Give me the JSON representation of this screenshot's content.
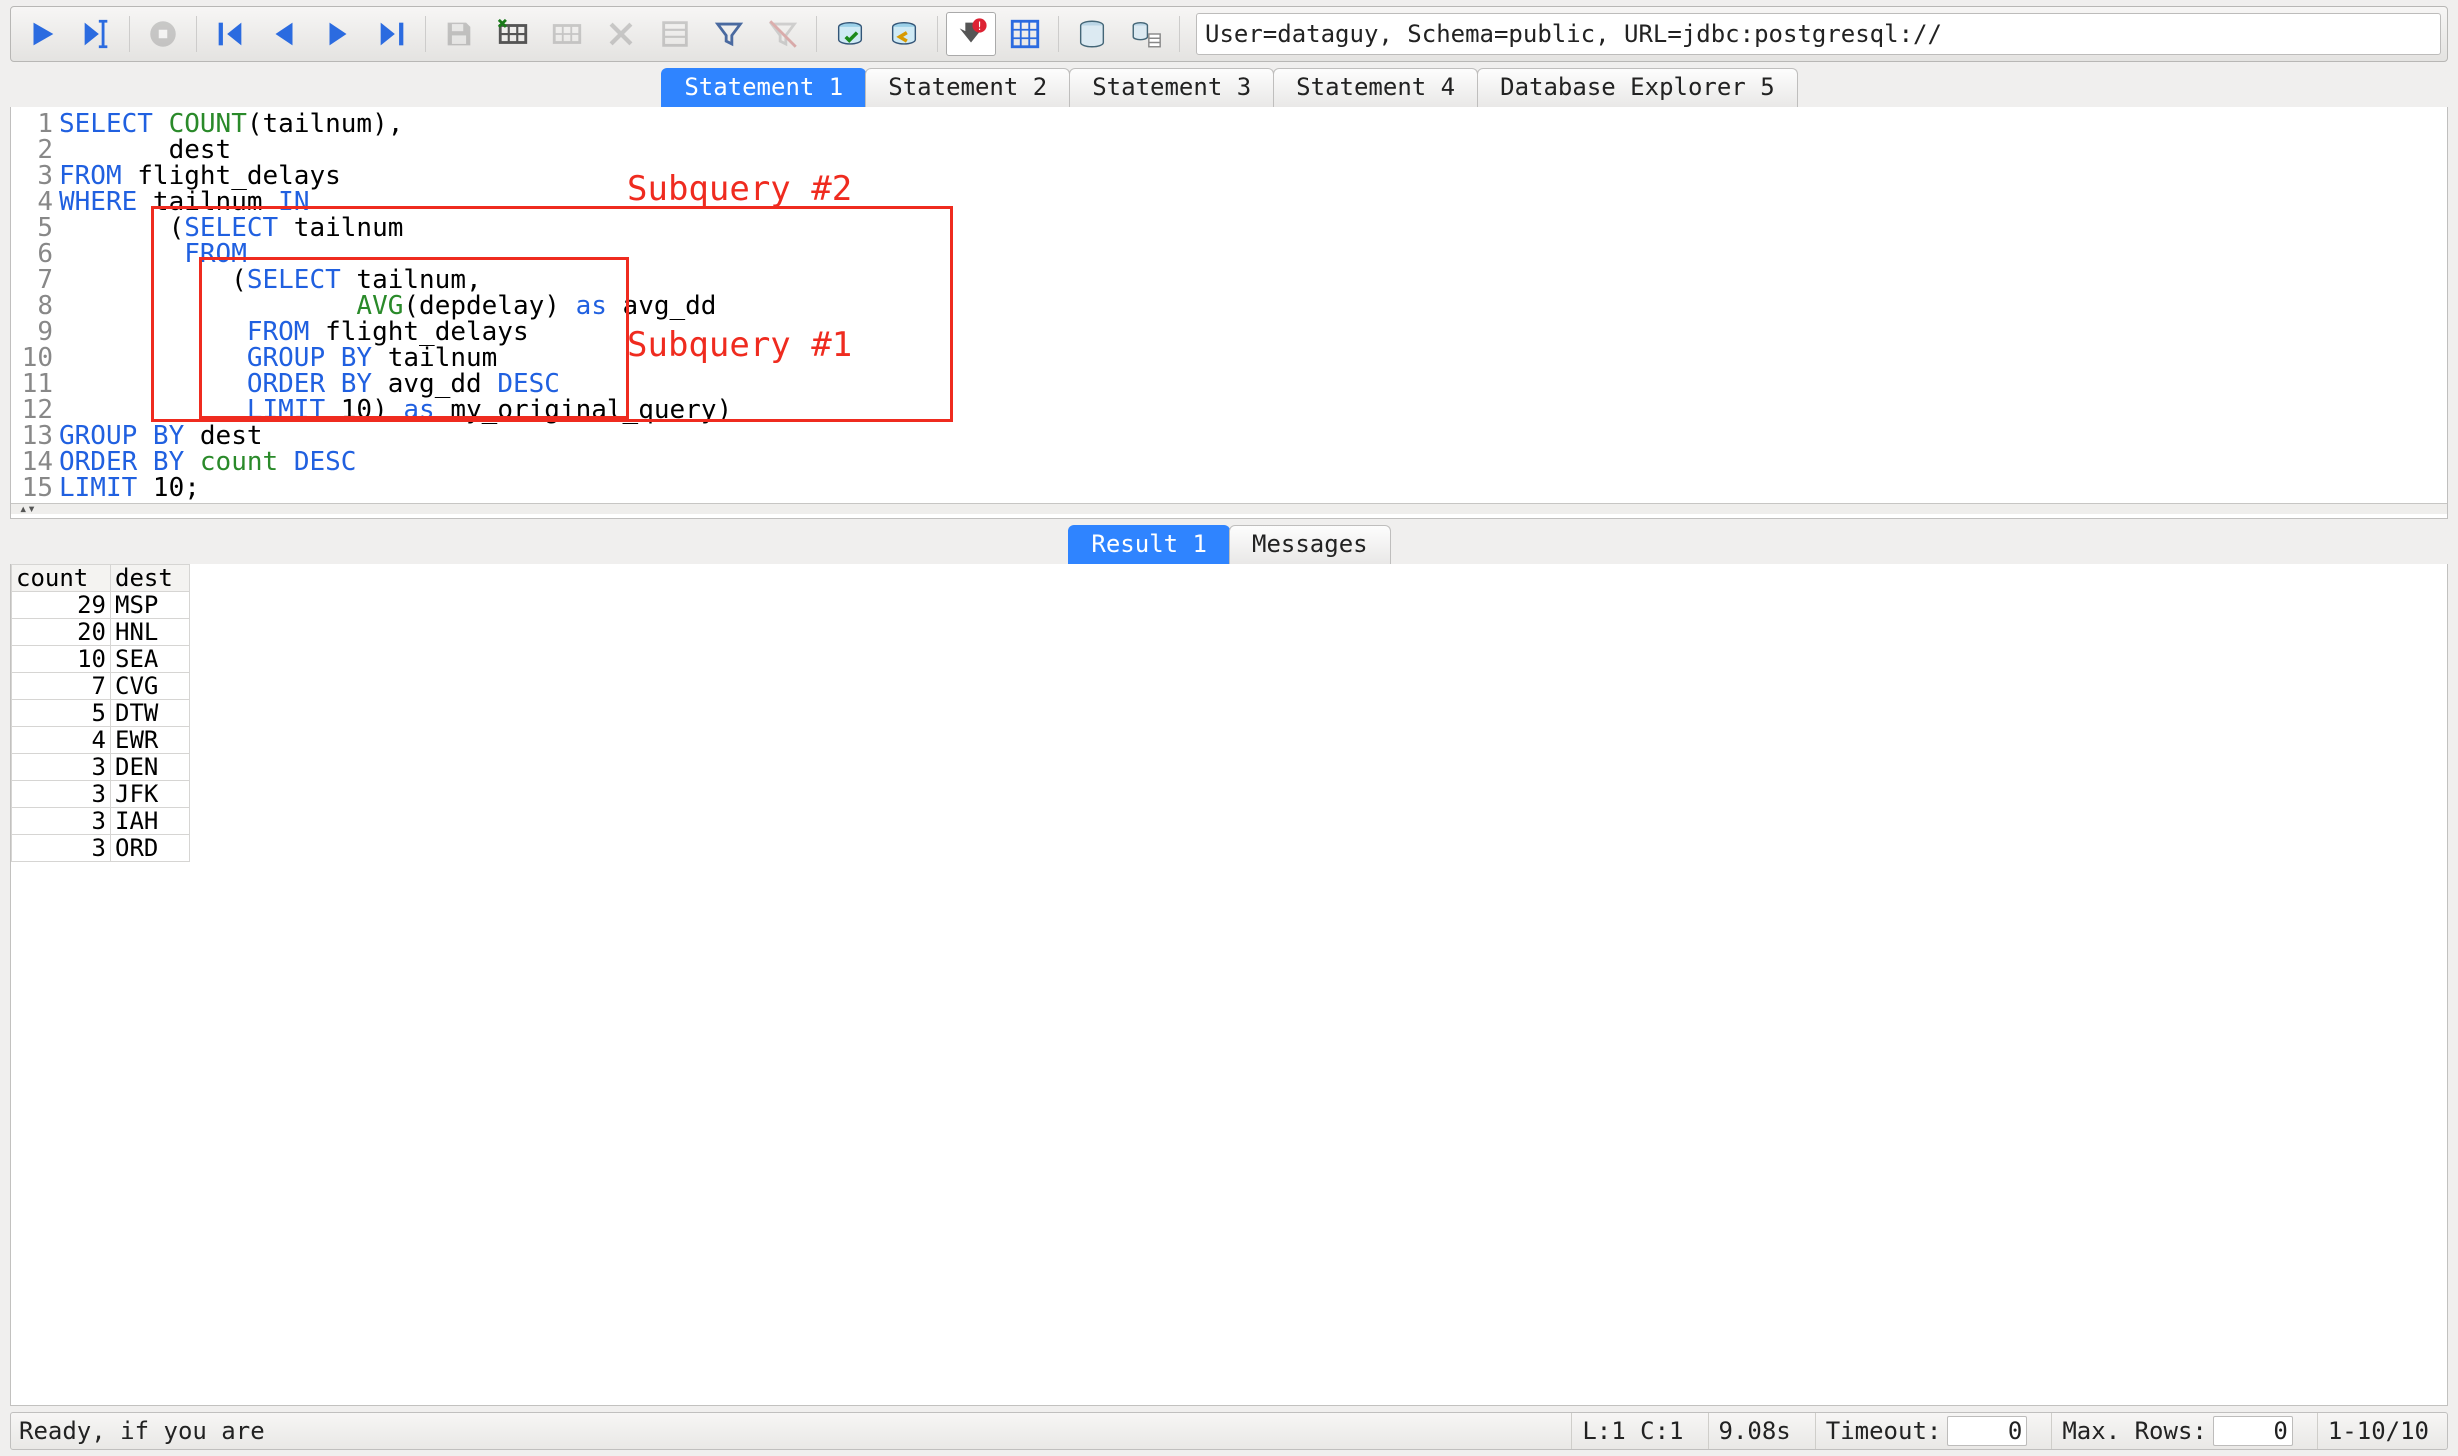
{
  "connection_info": "User=dataguy, Schema=public, URL=jdbc:postgresql://",
  "tabs": [
    "Statement 1",
    "Statement 2",
    "Statement 3",
    "Statement 4",
    "Database Explorer 5"
  ],
  "active_tab_index": 0,
  "code_lines": [
    [
      {
        "t": "SELECT ",
        "c": "kw"
      },
      {
        "t": "COUNT",
        "c": "fn"
      },
      {
        "t": "(tailnum),",
        "c": "plain"
      }
    ],
    [
      {
        "t": "       dest",
        "c": "plain"
      }
    ],
    [
      {
        "t": "FROM",
        "c": "kw"
      },
      {
        "t": " flight_delays",
        "c": "plain"
      }
    ],
    [
      {
        "t": "WHERE",
        "c": "kw"
      },
      {
        "t": " tailnum ",
        "c": "plain"
      },
      {
        "t": "IN",
        "c": "kw"
      }
    ],
    [
      {
        "t": "       (",
        "c": "plain"
      },
      {
        "t": "SELECT",
        "c": "kw"
      },
      {
        "t": " tailnum",
        "c": "plain"
      }
    ],
    [
      {
        "t": "        ",
        "c": "plain"
      },
      {
        "t": "FROM",
        "c": "kw"
      }
    ],
    [
      {
        "t": "           (",
        "c": "plain"
      },
      {
        "t": "SELECT",
        "c": "kw"
      },
      {
        "t": " tailnum,",
        "c": "plain"
      }
    ],
    [
      {
        "t": "                   ",
        "c": "plain"
      },
      {
        "t": "AVG",
        "c": "fn"
      },
      {
        "t": "(depdelay) ",
        "c": "plain"
      },
      {
        "t": "as",
        "c": "kw"
      },
      {
        "t": " avg_dd",
        "c": "plain"
      }
    ],
    [
      {
        "t": "            ",
        "c": "plain"
      },
      {
        "t": "FROM",
        "c": "kw"
      },
      {
        "t": " flight_delays",
        "c": "plain"
      }
    ],
    [
      {
        "t": "            ",
        "c": "plain"
      },
      {
        "t": "GROUP BY",
        "c": "kw"
      },
      {
        "t": " tailnum",
        "c": "plain"
      }
    ],
    [
      {
        "t": "            ",
        "c": "plain"
      },
      {
        "t": "ORDER BY",
        "c": "kw"
      },
      {
        "t": " avg_dd ",
        "c": "plain"
      },
      {
        "t": "DESC",
        "c": "kw"
      }
    ],
    [
      {
        "t": "            ",
        "c": "plain"
      },
      {
        "t": "LIMIT",
        "c": "kw"
      },
      {
        "t": " 10) ",
        "c": "plain"
      },
      {
        "t": "as",
        "c": "kw"
      },
      {
        "t": " my_original_query)",
        "c": "plain"
      }
    ],
    [
      {
        "t": "GROUP BY",
        "c": "kw"
      },
      {
        "t": " dest",
        "c": "plain"
      }
    ],
    [
      {
        "t": "ORDER BY",
        "c": "kw"
      },
      {
        "t": " ",
        "c": "plain"
      },
      {
        "t": "count",
        "c": "fn"
      },
      {
        "t": " ",
        "c": "plain"
      },
      {
        "t": "DESC",
        "c": "kw"
      }
    ],
    [
      {
        "t": "LIMIT",
        "c": "kw"
      },
      {
        "t": " 10;",
        "c": "plain"
      }
    ]
  ],
  "annotations": {
    "sub2_label": "Subquery #2",
    "sub1_label": "Subquery #1"
  },
  "result_tabs": [
    "Result 1",
    "Messages"
  ],
  "active_result_tab_index": 0,
  "result_columns": [
    "count",
    "dest"
  ],
  "result_rows": [
    {
      "count": 29,
      "dest": "MSP"
    },
    {
      "count": 20,
      "dest": "HNL"
    },
    {
      "count": 10,
      "dest": "SEA"
    },
    {
      "count": 7,
      "dest": "CVG"
    },
    {
      "count": 5,
      "dest": "DTW"
    },
    {
      "count": 4,
      "dest": "EWR"
    },
    {
      "count": 3,
      "dest": "DEN"
    },
    {
      "count": 3,
      "dest": "JFK"
    },
    {
      "count": 3,
      "dest": "IAH"
    },
    {
      "count": 3,
      "dest": "ORD"
    }
  ],
  "status": {
    "ready": "Ready, if you are",
    "cursor": "L:1 C:1",
    "time": "9.08s",
    "timeout_label": "Timeout:",
    "timeout_value": "0",
    "maxrows_label": "Max. Rows:",
    "maxrows_value": "0",
    "range": "1-10/10"
  },
  "icons": {
    "run": "run-icon",
    "run_cursor": "run-to-cursor-icon",
    "stop": "stop-icon",
    "first": "first-record-icon",
    "prev": "prev-record-icon",
    "next": "next-record-icon",
    "last": "last-record-icon",
    "save": "save-icon",
    "insert_row": "insert-row-icon",
    "copy_row": "copy-row-icon",
    "delete_row": "delete-row-icon",
    "select": "select-columns-icon",
    "filter": "filter-icon",
    "clear_filter": "clear-filter-icon",
    "commit": "commit-icon",
    "rollback": "rollback-icon",
    "autocommit": "toggle-autocommit-icon",
    "grid": "append-results-icon",
    "db1": "show-dbexplorer-icon",
    "db2": "show-dbtree-icon"
  }
}
